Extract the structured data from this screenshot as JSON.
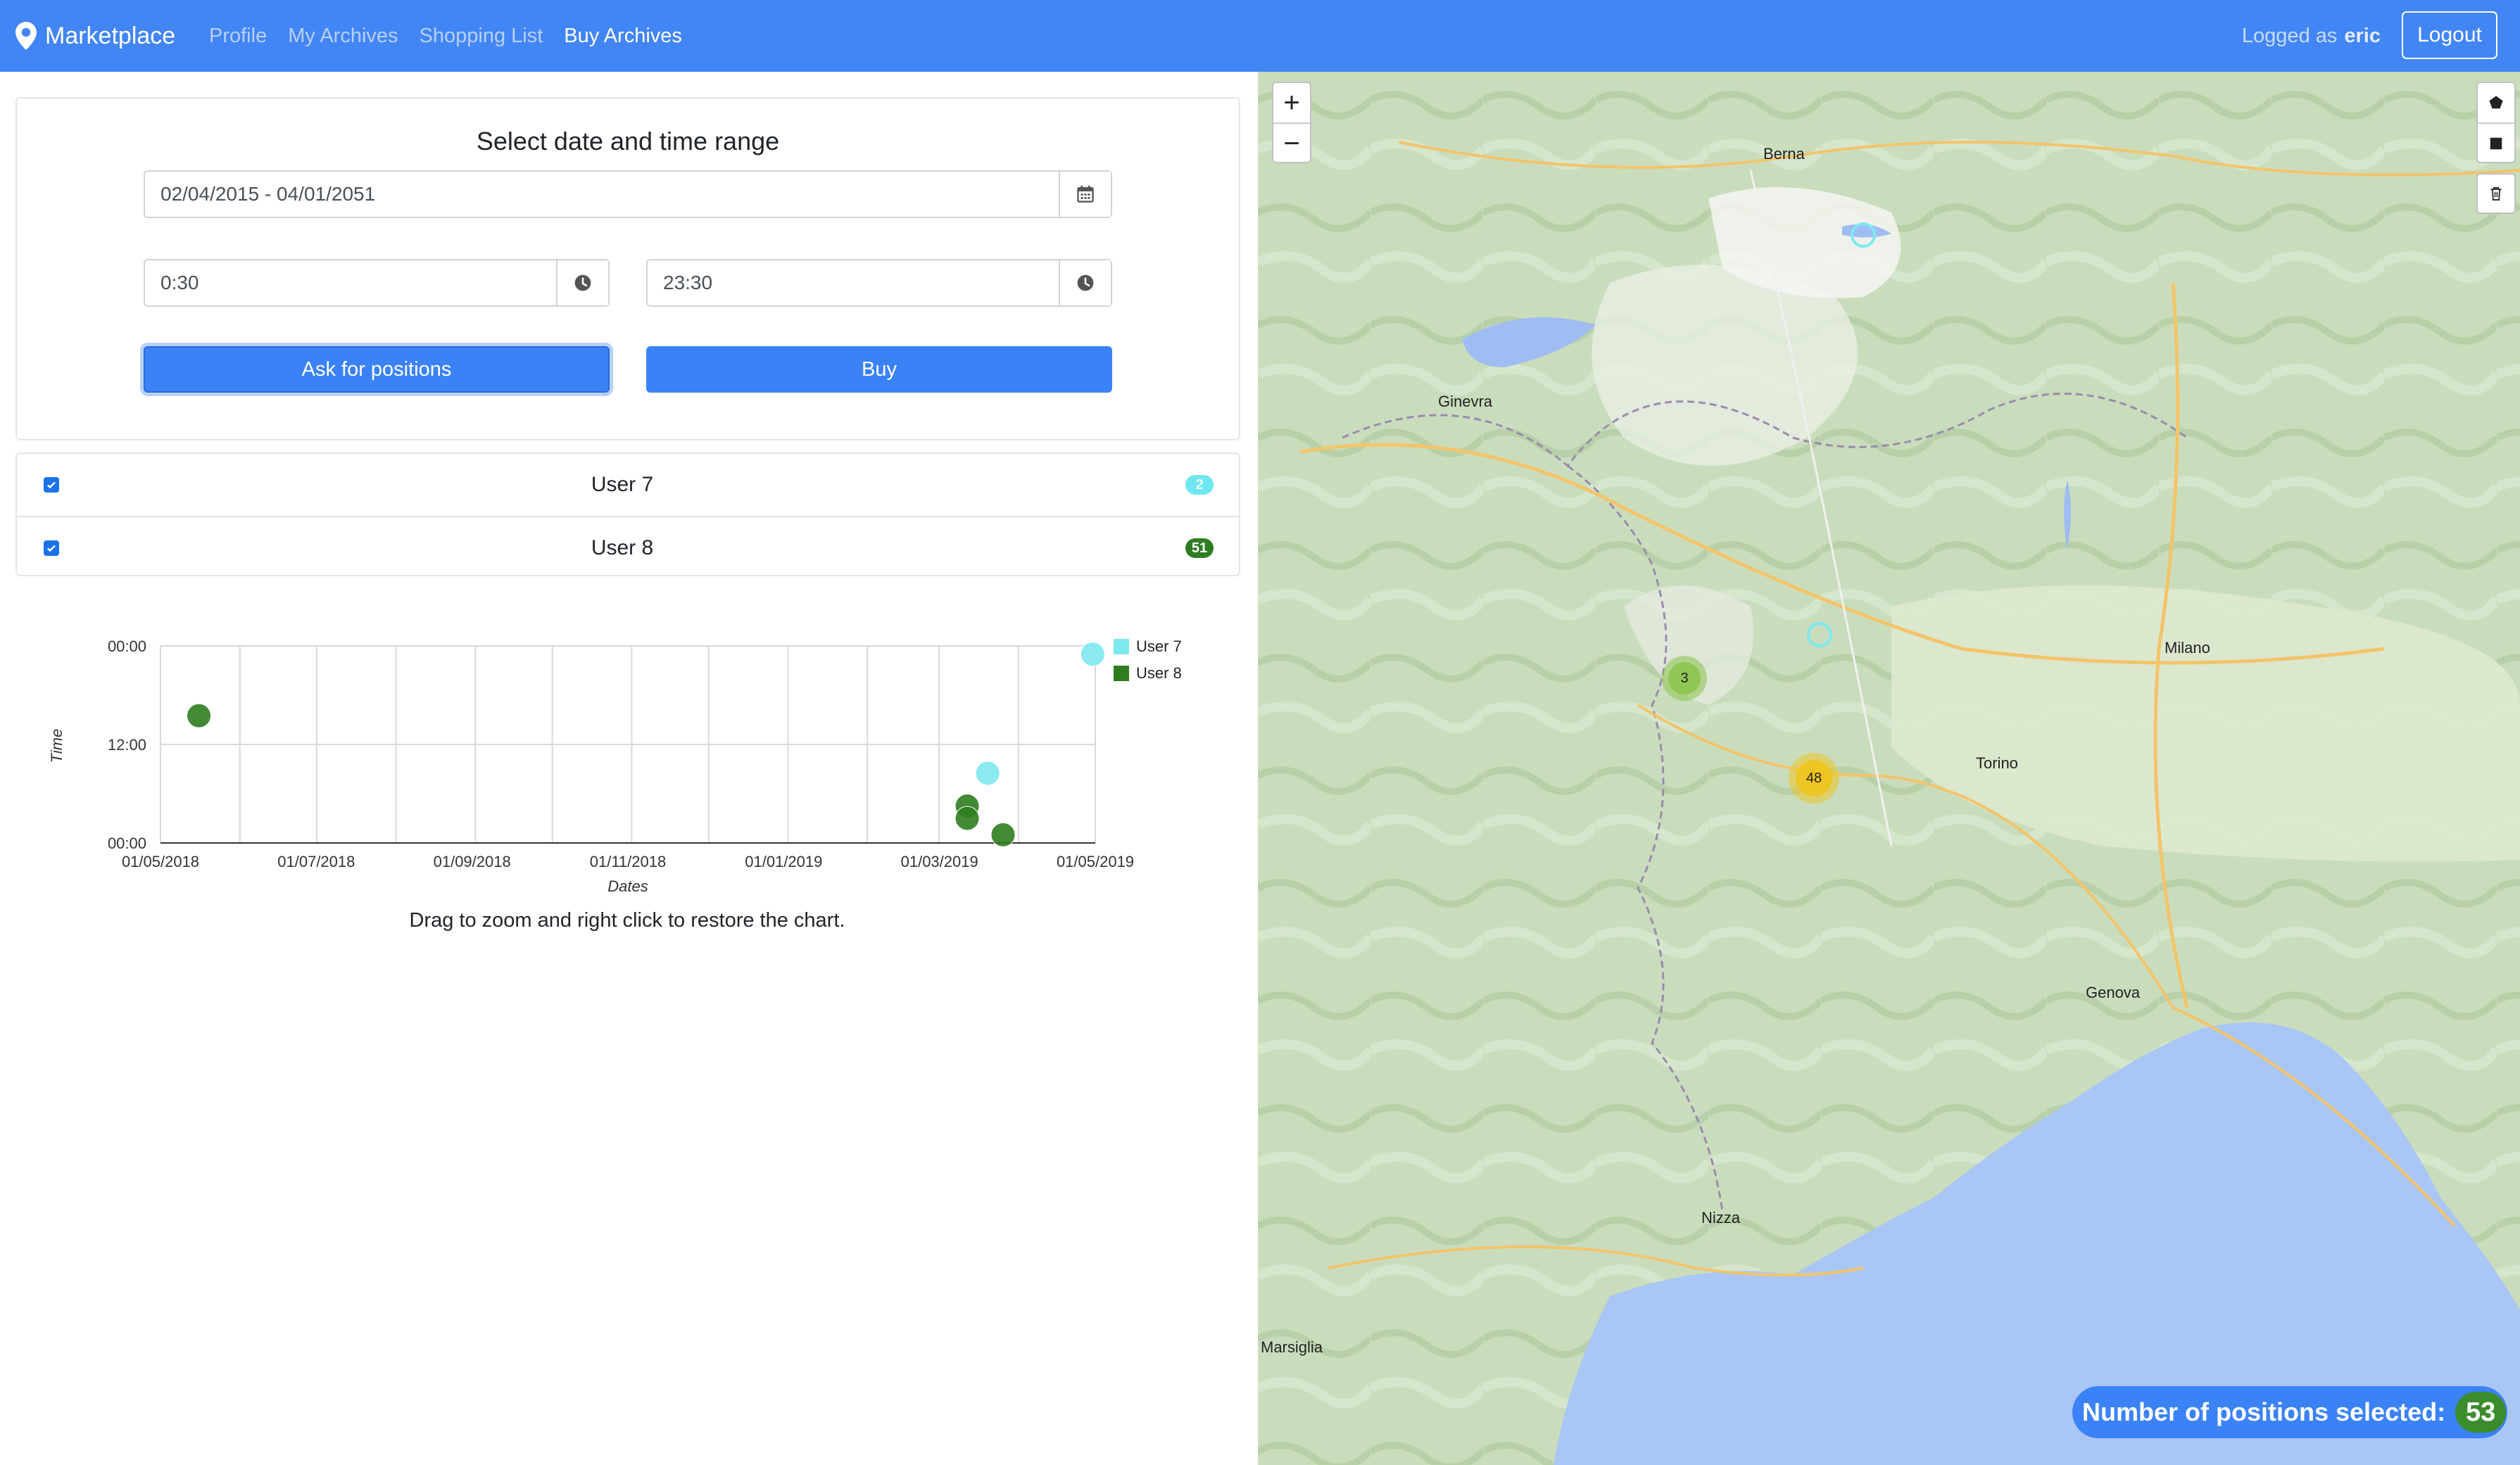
{
  "navbar": {
    "brand": "Marketplace",
    "links": [
      {
        "label": "Profile",
        "active": false
      },
      {
        "label": "My Archives",
        "active": false
      },
      {
        "label": "Shopping List",
        "active": false
      },
      {
        "label": "Buy Archives",
        "active": true
      }
    ],
    "logged_prefix": "Logged as",
    "username": "eric",
    "logout_label": "Logout",
    "color": "#4285f4"
  },
  "filter": {
    "title": "Select date and time range",
    "date_range": "02/04/2015 - 04/01/2051",
    "time_from": "0:30",
    "time_to": "23:30",
    "ask_label": "Ask for positions",
    "buy_label": "Buy"
  },
  "users": [
    {
      "name": "User 7",
      "checked": true,
      "count": "2",
      "badge_color": "#6fe7ef"
    },
    {
      "name": "User 8",
      "checked": true,
      "count": "51",
      "badge_color": "#2e7d22"
    }
  ],
  "chart_data": {
    "type": "scatter",
    "xlabel": "Dates",
    "ylabel": "Time",
    "x_ticks": [
      "01/05/2018",
      "01/07/2018",
      "01/09/2018",
      "01/11/2018",
      "01/01/2019",
      "01/03/2019",
      "01/05/2019"
    ],
    "y_ticks": [
      "00:00",
      "12:00",
      "00:00"
    ],
    "legend_position": "top-right",
    "series": [
      {
        "name": "User 7",
        "color": "#7ee8f0",
        "points": [
          [
            "2019-03-20",
            "08:30"
          ],
          [
            "2019-04-30",
            "23:00"
          ]
        ]
      },
      {
        "name": "User 8",
        "color": "#2f7d1f",
        "points": [
          [
            "2018-05-16",
            "15:30"
          ],
          [
            "2019-03-12",
            "04:30"
          ],
          [
            "2019-03-12",
            "03:00"
          ],
          [
            "2019-03-26",
            "01:00"
          ]
        ]
      }
    ],
    "note": "Drag to zoom and right click to restore the chart."
  },
  "map": {
    "clusters": [
      {
        "count": "3",
        "color": "#8bc34a"
      },
      {
        "count": "48",
        "color": "#f0c419"
      }
    ],
    "labels": [
      "Berna",
      "Ginevra",
      "Milano",
      "Genova",
      "Nizza",
      "Marsiglia",
      "Torino"
    ],
    "positions_label": "Number of positions selected:",
    "positions_count": "53"
  }
}
